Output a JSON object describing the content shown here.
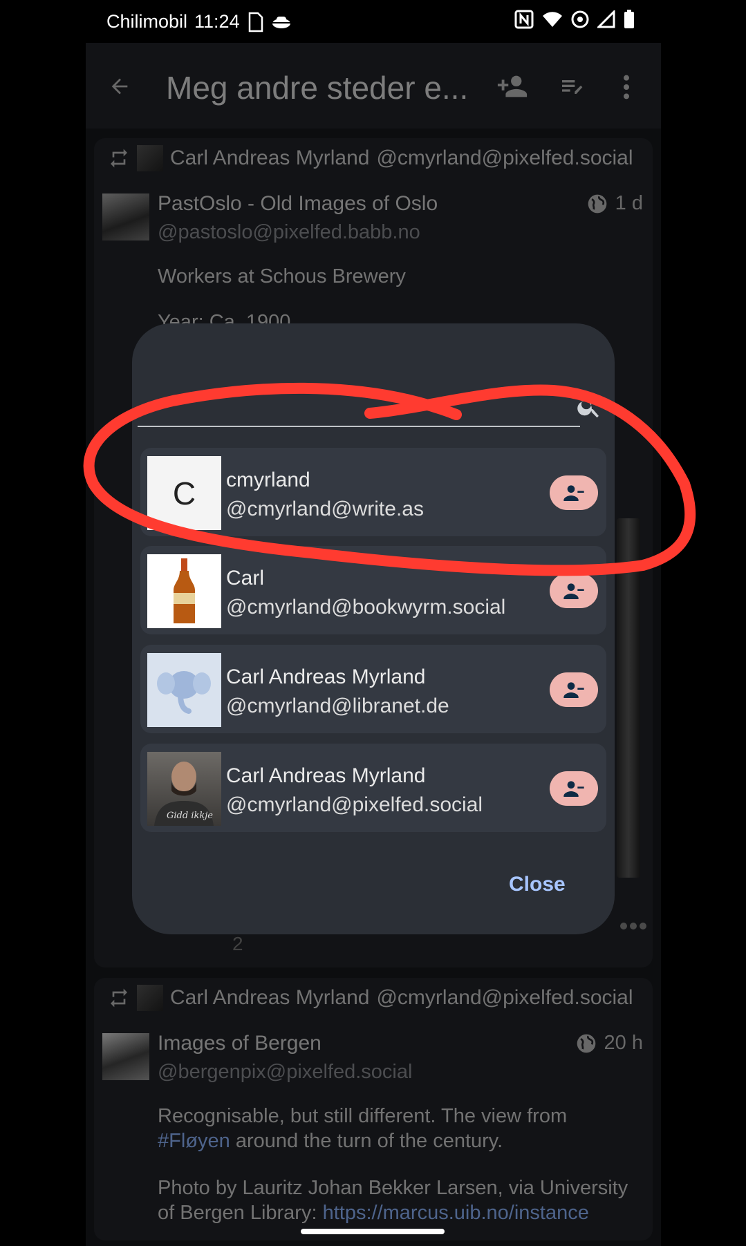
{
  "status_bar": {
    "carrier": "Chilimobil",
    "time": "11:24"
  },
  "app_bar": {
    "title": "Meg andre steder e..."
  },
  "post1": {
    "boosted_by": "Carl Andreas Myrland",
    "boosted_by_acct": "@cmyrland@pixelfed.social",
    "author": "PastOslo - Old Images of Oslo",
    "author_acct": "@pastoslo@pixelfed.babb.no",
    "time": "1 d",
    "text_line1": "Workers at Schous Brewery",
    "text_line2": "Year: Ca. 1900",
    "boost_count": "2"
  },
  "dialog": {
    "items": [
      {
        "name": "cmyrland",
        "acct": "@cmyrland@write.as",
        "initial": "C"
      },
      {
        "name": "Carl",
        "acct": "@cmyrland@bookwyrm.social"
      },
      {
        "name": "Carl Andreas Myrland",
        "acct": "@cmyrland@libranet.de"
      },
      {
        "name": "Carl Andreas Myrland",
        "acct": "@cmyrland@pixelfed.social",
        "shirt_text": "Gidd ikkje"
      }
    ],
    "close_label": "Close"
  },
  "post2": {
    "boosted_by": "Carl Andreas Myrland",
    "boosted_by_acct": "@cmyrland@pixelfed.social",
    "author": "Images of Bergen",
    "author_acct": "@bergenpix@pixelfed.social",
    "time": "20 h",
    "text_part1": "Recognisable, but still different. The view from",
    "hashtag": "#Fløyen",
    "text_part2": " around the turn of the century.",
    "text_line3": "Photo by Lauritz Johan Bekker Larsen, via University",
    "text_line4_prefix": "of Bergen Library: ",
    "text_line4_link": "https://marcus.uib.no/instance"
  },
  "colors": {
    "accent": "#a7c5ff",
    "unfollow_bg": "#f0b5b0",
    "annotation": "#ff3b30"
  }
}
